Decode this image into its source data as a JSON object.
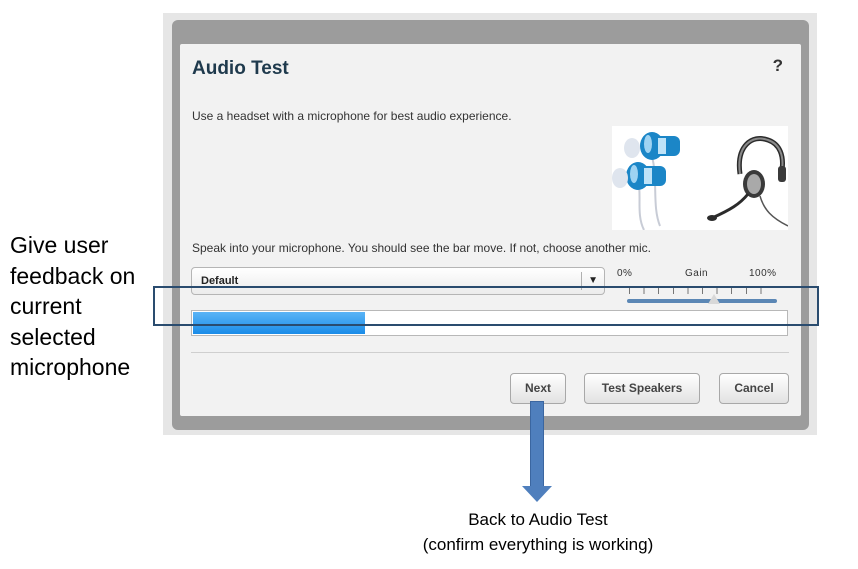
{
  "dialog": {
    "title": "Audio Test",
    "help_label": "?",
    "intro": "Use a headset with a microphone for best audio experience.",
    "instruction": "Speak into your microphone. You should see the bar move. If not, choose another mic.",
    "mic_select": {
      "value": "Default",
      "caret": "▼"
    },
    "gain": {
      "min_label": "0%",
      "label": "Gain",
      "max_label": "100%",
      "level_fraction": 0.58
    },
    "mic_level_fraction": 0.29,
    "buttons": {
      "next": "Next",
      "test_speakers": "Test Speakers",
      "cancel": "Cancel"
    }
  },
  "annotations": {
    "side_note": "Give user feedback on current selected microphone",
    "arrow_note_line1": "Back to Audio Test",
    "arrow_note_line2": "(confirm everything is working)"
  },
  "colors": {
    "meter_fill": "#1a8ce8",
    "highlight_border": "#2a4c6f",
    "arrow": "#4f7fbd",
    "title": "#1f3a4d"
  },
  "icons": {
    "illustration": "earbuds-and-headset-image",
    "help": "help-icon",
    "dropdown": "chevron-down-icon"
  }
}
